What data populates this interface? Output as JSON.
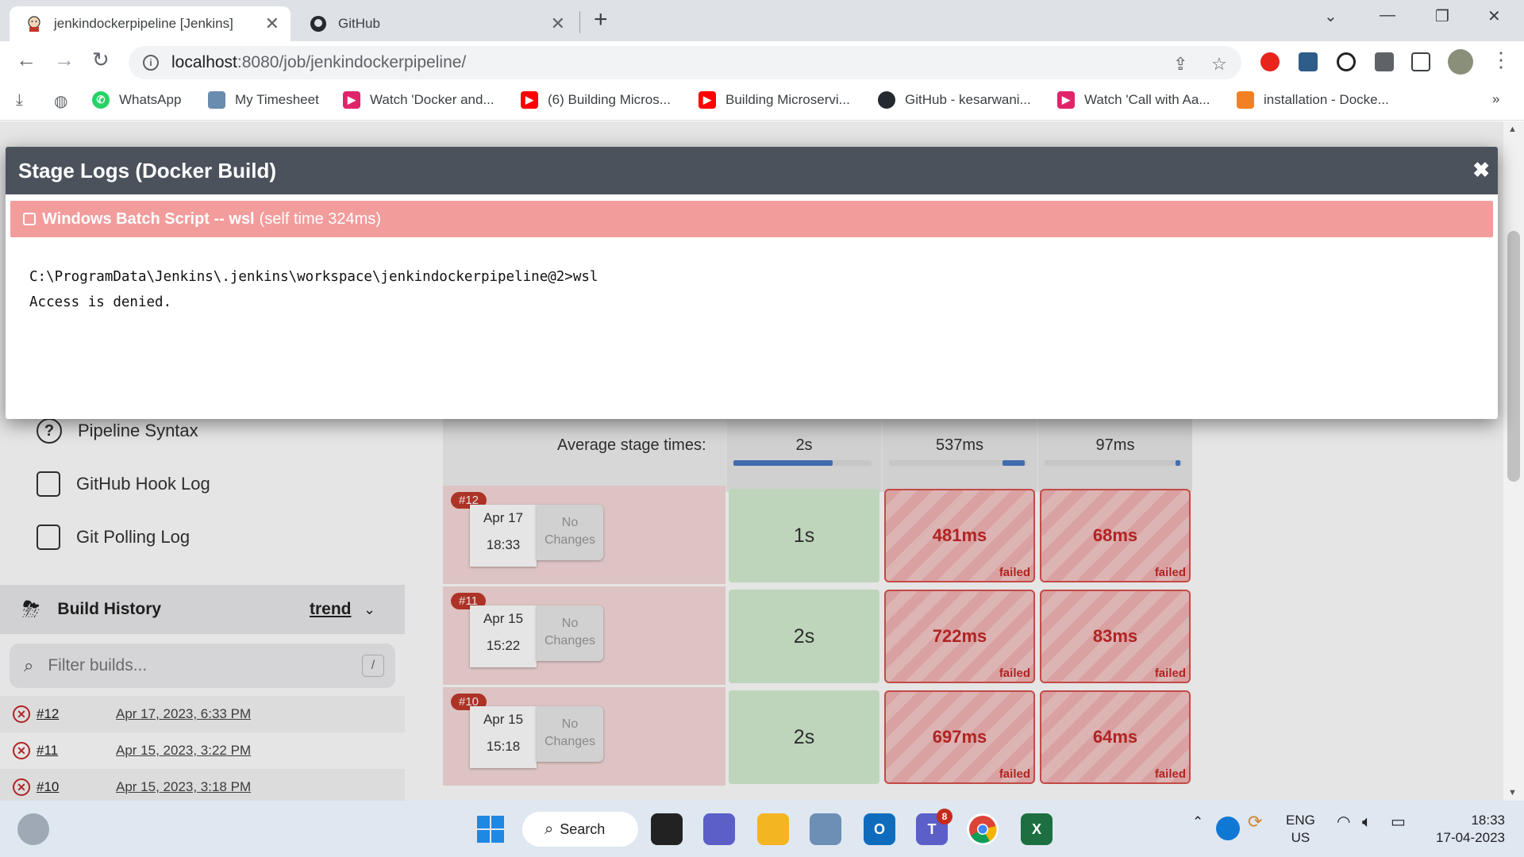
{
  "browser": {
    "tabs": [
      {
        "title": "jenkindockerpipeline [Jenkins]",
        "active": true
      },
      {
        "title": "GitHub",
        "active": false
      }
    ],
    "url_host": "localhost",
    "url_rest": ":8080/job/jenkindockerpipeline/",
    "bookmarks": [
      {
        "label": "WhatsApp",
        "icon": "whatsapp-icon",
        "color": "#25d366"
      },
      {
        "label": "My Timesheet",
        "icon": "timesheet-icon",
        "color": "#6a8caf"
      },
      {
        "label": "Watch 'Docker and...",
        "icon": "play-icon",
        "color": "#e0246a"
      },
      {
        "label": "(6) Building Micros...",
        "icon": "youtube-icon",
        "color": "#ff0000"
      },
      {
        "label": "Building Microservi...",
        "icon": "youtube-icon",
        "color": "#ff0000"
      },
      {
        "label": "GitHub - kesarwani...",
        "icon": "github-icon",
        "color": "#24292f"
      },
      {
        "label": "Watch 'Call with Aa...",
        "icon": "play-icon",
        "color": "#e0246a"
      },
      {
        "label": "installation - Docke...",
        "icon": "stackoverflow-icon",
        "color": "#f48024"
      }
    ]
  },
  "sidebar": {
    "items": [
      "Pipeline Syntax",
      "GitHub Hook Log",
      "Git Polling Log"
    ],
    "build_history_title": "Build History",
    "trend_label": "trend",
    "filter_placeholder": "Filter builds...",
    "filter_shortcut": "/",
    "builds": [
      {
        "number": "#12",
        "date": "Apr 17, 2023, 6:33 PM"
      },
      {
        "number": "#11",
        "date": "Apr 15, 2023, 3:22 PM"
      },
      {
        "number": "#10",
        "date": "Apr 15, 2023, 3:18 PM"
      }
    ]
  },
  "stage_view": {
    "average_label": "Average stage times:",
    "averages": [
      {
        "time": "2s",
        "fill": 0.72
      },
      {
        "time": "537ms",
        "fill": 0.16
      },
      {
        "time": "97ms",
        "fill": 0.03
      }
    ],
    "runs": [
      {
        "badge": "#12",
        "month_day": "Apr 17",
        "time": "18:33",
        "changes": "No Changes",
        "cells": [
          "1s",
          "481ms",
          "68ms"
        ]
      },
      {
        "badge": "#11",
        "month_day": "Apr 15",
        "time": "15:22",
        "changes": "No Changes",
        "cells": [
          "2s",
          "722ms",
          "83ms"
        ]
      },
      {
        "badge": "#10",
        "month_day": "Apr 15",
        "time": "15:18",
        "changes": "No Changes",
        "cells": [
          "2s",
          "697ms",
          "64ms"
        ]
      }
    ],
    "failed_label": "failed"
  },
  "modal": {
    "title": "Stage Logs (Docker Build)",
    "step_title": "Windows Batch Script -- wsl",
    "step_time": "(self time 324ms)",
    "log_lines": [
      "C:\\ProgramData\\Jenkins\\.jenkins\\workspace\\jenkindockerpipeline@2>wsl",
      "Access is denied."
    ]
  },
  "taskbar": {
    "search_label": "Search",
    "teams_badge": "8",
    "lang_line1": "ENG",
    "lang_line2": "US",
    "clock_time": "18:33",
    "clock_date": "17-04-2023"
  },
  "colors": {
    "failed_red": "#c62828",
    "success_green": "#d4eed2",
    "modal_header": "#4b525c",
    "step_bar": "#f29c9c"
  }
}
